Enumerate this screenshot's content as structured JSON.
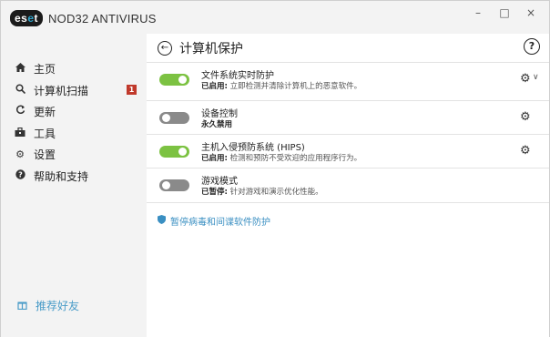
{
  "app": {
    "logo_text": "eset",
    "product_name": "NOD32 ANTIVIRUS"
  },
  "window_controls": {
    "minimize": "–",
    "maximize": "□",
    "close": "×"
  },
  "sidebar": {
    "items": [
      {
        "label": "主页",
        "icon": "home-icon"
      },
      {
        "label": "计算机扫描",
        "icon": "search-icon",
        "badge": "1"
      },
      {
        "label": "更新",
        "icon": "refresh-icon"
      },
      {
        "label": "工具",
        "icon": "toolbox-icon"
      },
      {
        "label": "设置",
        "icon": "gear-icon"
      },
      {
        "label": "帮助和支持",
        "icon": "help-icon"
      }
    ],
    "recommend": "推荐好友"
  },
  "main": {
    "title": "计算机保护",
    "help": "?",
    "rows": [
      {
        "title": "文件系统实时防护",
        "status": "已启用:",
        "desc": " 立即检测并清除计算机上的恶意软件。",
        "enabled": true
      },
      {
        "title": "设备控制",
        "status": "永久禁用",
        "desc": "",
        "enabled": false
      },
      {
        "title": "主机入侵预防系统 (HIPS)",
        "status": "已启用:",
        "desc": " 检测和预防不受欢迎的应用程序行为。",
        "enabled": true
      },
      {
        "title": "游戏模式",
        "status": "已暂停:",
        "desc": " 针对游戏和演示优化性能。",
        "enabled": false
      }
    ],
    "pause_link": "暂停病毒和间谍软件防护"
  },
  "colors": {
    "toggle_on": "#7cc242",
    "toggle_off": "#8a8a8a",
    "badge": "#c0392b",
    "link": "#3a8fc2"
  }
}
